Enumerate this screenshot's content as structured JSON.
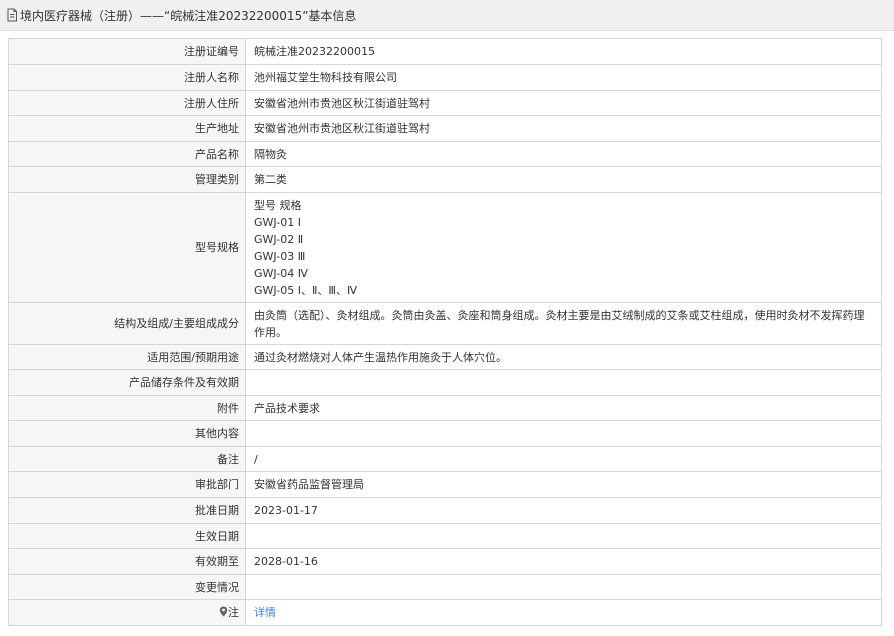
{
  "header": {
    "title": "境内医疗器械（注册）——“皖械注准20232200015”基本信息"
  },
  "rows": [
    {
      "label": "注册证编号",
      "value": "皖械注准20232200015"
    },
    {
      "label": "注册人名称",
      "value": "池州福艾堂生物科技有限公司"
    },
    {
      "label": "注册人住所",
      "value": "安徽省池州市贵池区秋江街道驻驾村"
    },
    {
      "label": "生产地址",
      "value": "安徽省池州市贵池区秋江街道驻驾村"
    },
    {
      "label": "产品名称",
      "value": "隔物灸"
    },
    {
      "label": "管理类别",
      "value": "第二类"
    },
    {
      "label": "型号规格",
      "lines": [
        "型号 规格",
        "GWJ-01 Ⅰ",
        "GWJ-02 Ⅱ",
        "GWJ-03 Ⅲ",
        "GWJ-04 Ⅳ",
        "GWJ-05 Ⅰ、Ⅱ、Ⅲ、Ⅳ"
      ]
    },
    {
      "label": "结构及组成/主要组成成分",
      "value": "由灸筒（选配）、灸材组成。灸筒由灸盖、灸座和筒身组成。灸材主要是由艾绒制成的艾条或艾柱组成，使用时灸材不发挥药理作用。"
    },
    {
      "label": "适用范围/预期用途",
      "value": "通过灸材燃烧对人体产生温热作用施灸于人体穴位。"
    },
    {
      "label": "产品储存条件及有效期",
      "value": ""
    },
    {
      "label": "附件",
      "value": "产品技术要求"
    },
    {
      "label": "其他内容",
      "value": ""
    },
    {
      "label": "备注",
      "value": "/"
    },
    {
      "label": "审批部门",
      "value": "安徽省药品监督管理局"
    },
    {
      "label": "批准日期",
      "value": "2023-01-17"
    },
    {
      "label": "生效日期",
      "value": ""
    },
    {
      "label": "有效期至",
      "value": "2028-01-16"
    },
    {
      "label": "变更情况",
      "value": ""
    },
    {
      "label": "注",
      "value": "详情"
    }
  ],
  "icons": {
    "header": "document-icon",
    "note": "map-pin-icon"
  }
}
